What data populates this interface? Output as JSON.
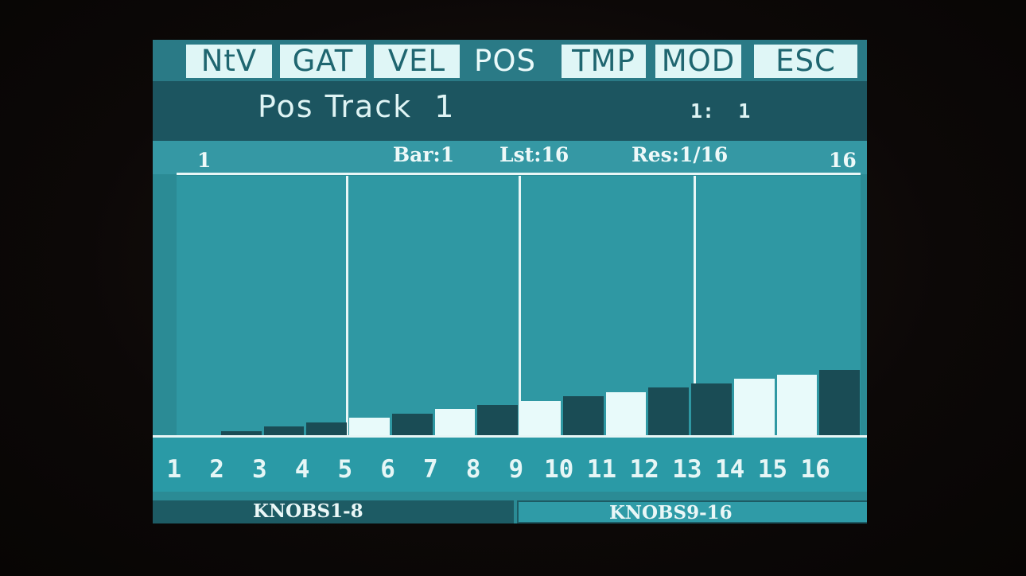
{
  "tabs": [
    "NtV",
    "GAT",
    "VEL",
    "POS",
    "TMP",
    "MOD",
    "ESC"
  ],
  "title": "Pos Track  1",
  "position": "1:  1",
  "info": {
    "start": "1",
    "bar": "Bar:1",
    "last": "Lst:16",
    "res": "Res:1/16",
    "end": "16"
  },
  "steps": [
    "1",
    "2",
    "3",
    "4",
    "5",
    "6",
    "7",
    "8",
    "9",
    "10",
    "11",
    "12",
    "13",
    "14",
    "15",
    "16"
  ],
  "step_values": [
    0,
    1,
    2,
    3,
    4,
    5,
    6,
    7,
    8,
    9,
    10,
    11,
    12,
    13,
    14,
    15
  ],
  "step_max": 60,
  "highlighted_steps": [
    5,
    7,
    9,
    11,
    14,
    15
  ],
  "knobs": {
    "left": "KNOBS1-8",
    "right": "KNOBS9-16"
  },
  "colors": {
    "screen": "#2b8b95",
    "bar_dark": "#1a4c55",
    "bar_light": "#e8fafa",
    "text_light": "#e8f6f6"
  }
}
